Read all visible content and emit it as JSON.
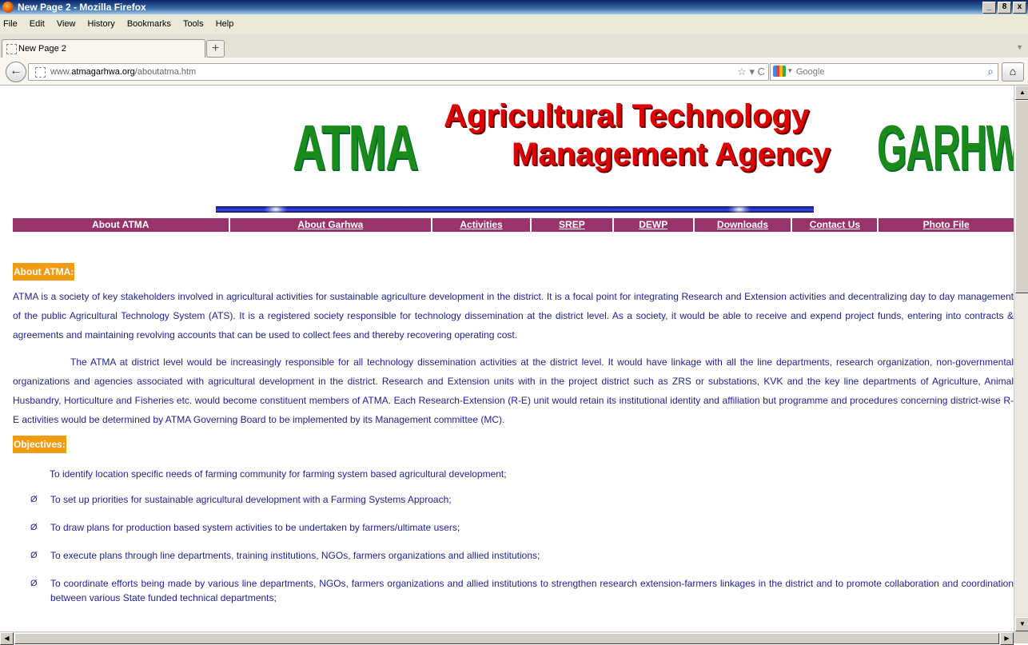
{
  "window": {
    "title": "New Page 2 - Mozilla Firefox",
    "buttons": [
      "_",
      "8",
      "x"
    ]
  },
  "menubar": [
    "File",
    "Edit",
    "View",
    "History",
    "Bookmarks",
    "Tools",
    "Help"
  ],
  "tab": {
    "label": "New Page 2",
    "new_tab": "+"
  },
  "url": {
    "prefix": "www.",
    "domain": "atmagarhwa.org",
    "path": "/aboutatma.htm"
  },
  "search": {
    "placeholder": "Google"
  },
  "header": {
    "atma": "ATMA",
    "line1": "Agricultural Technology",
    "line2": "Management Agency",
    "garhwa": "GARHWA"
  },
  "nav": [
    {
      "label": "About ATMA"
    },
    {
      "label": "About Garhwa"
    },
    {
      "label": "Activities"
    },
    {
      "label": "SREP"
    },
    {
      "label": "DEWP"
    },
    {
      "label": "Downloads"
    },
    {
      "label": "Contact Us"
    },
    {
      "label": "Photo File"
    }
  ],
  "about": {
    "heading": "About ATMA:",
    "para1": "ATMA is a society of key stakeholders involved in agricultural activities for sustainable agriculture development in the district. It is a focal point for integrating Research and Extension activities and decentralizing day to day management of the public Agricultural Technology System (ATS). It is a registered society responsible for technology dissemination at the district level. As a society, it would be able to receive and expend project funds, entering into contracts & agreements and maintaining revolving accounts that can be used to collect fees and thereby recovering operating cost.",
    "para2": "The ATMA at district level would be increasingly responsible for all technology dissemination activities at the district level. It would have linkage with all the line departments, research organization, non-governmental organizations and agencies associated with agricultural development in the district. Research and Extension units with in the project district such as ZRS or substations, KVK and the key line departments of Agriculture, Animal Husbandry, Horticulture and Fisheries etc. would become constituent members of ATMA.  Each Research-Extension (R-E) unit would retain its institutional identity and affiliation but programme and procedures concerning district-wise R-E activities would be determined by ATMA Governing Board to be implemented by its Management committee (MC)."
  },
  "objectives": {
    "heading": "Objectives:",
    "intro": "To identify location specific needs of farming community for farming system based agricultural development;",
    "bullet": "Ø",
    "items": [
      "To set up priorities for sustainable agricultural development with a Farming Systems Approach;",
      "To draw plans for production based system activities to be undertaken by farmers/ultimate users;",
      "To execute plans through line departments, training institutions, NGOs, farmers organizations and allied institutions;",
      "To coordinate efforts being made by various line departments, NGOs, farmers organizations and allied institutions to strengthen research extension-farmers linkages in the district and to promote collaboration and coordination between various State funded technical departments;"
    ]
  }
}
